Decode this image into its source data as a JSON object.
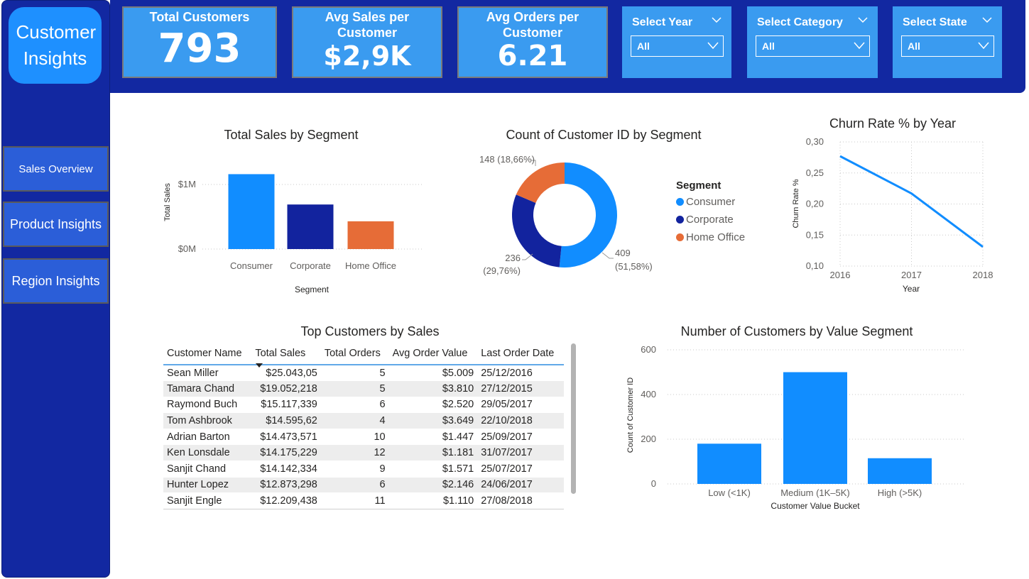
{
  "app": {
    "title": "Customer Insights"
  },
  "nav": [
    {
      "label": "Sales Overview"
    },
    {
      "label": "Product Insights"
    },
    {
      "label": "Region Insights"
    }
  ],
  "kpis": [
    {
      "title": "Total Customers",
      "value": "793"
    },
    {
      "title": "Avg Sales per Customer",
      "value": "$2,9K"
    },
    {
      "title": "Avg Orders per Customer",
      "value": "6.21"
    }
  ],
  "slicers": [
    {
      "title": "Select Year",
      "value": "All"
    },
    {
      "title": "Select Category",
      "value": "All"
    },
    {
      "title": "Select State",
      "value": "All"
    }
  ],
  "colors": {
    "navy": "#1228A1",
    "blue": "#118DFF",
    "darkblue": "#12239E",
    "orange": "#E66C37",
    "card": "#3A9BF0"
  },
  "charts": {
    "sales_by_segment": {
      "title": "Total Sales by Segment",
      "chart_data": {
        "type": "bar",
        "title": "Total Sales by Segment",
        "xlabel": "Segment",
        "ylabel": "Total Sales",
        "categories": [
          "Consumer",
          "Corporate",
          "Home Office"
        ],
        "values": [
          1160000,
          690000,
          430000
        ],
        "yticks": [
          "$0M",
          "$1M"
        ],
        "ylim": [
          0,
          1300000
        ],
        "colors": [
          "#118DFF",
          "#12239E",
          "#E66C37"
        ]
      }
    },
    "customer_count_by_segment": {
      "title": "Count of Customer ID by Segment",
      "legend_title": "Segment",
      "chart_data": {
        "type": "pie",
        "title": "Count of Customer ID by Segment",
        "categories": [
          "Consumer",
          "Corporate",
          "Home Office"
        ],
        "values": [
          409,
          236,
          148
        ],
        "labels": [
          "409",
          "(51,58%)",
          "236",
          "(29,76%)",
          "148 (18,66%)"
        ],
        "colors": [
          "#118DFF",
          "#12239E",
          "#E66C37"
        ],
        "legend": "right"
      }
    },
    "churn_rate": {
      "title": "Churn Rate % by Year",
      "chart_data": {
        "type": "line",
        "title": "Churn Rate % by Year",
        "xlabel": "Year",
        "ylabel": "Churn Rate %",
        "x": [
          "2016",
          "2017",
          "2018"
        ],
        "values": [
          0.277,
          0.217,
          0.131
        ],
        "yticks": [
          "0,10",
          "0,15",
          "0,20",
          "0,25",
          "0,30"
        ],
        "ylim": [
          0.1,
          0.3
        ],
        "grid": true
      }
    },
    "value_segment": {
      "title": "Number of Customers by Value Segment",
      "chart_data": {
        "type": "bar",
        "title": "Number of Customers by Value Segment",
        "xlabel": "Customer Value Bucket",
        "ylabel": "Count of Customer ID",
        "categories": [
          "Low (<1K)",
          "Medium (1K–5K)",
          "High (>5K)"
        ],
        "values": [
          180,
          500,
          115
        ],
        "yticks": [
          "0",
          "200",
          "400",
          "600"
        ],
        "ylim": [
          0,
          600
        ],
        "grid": true
      }
    }
  },
  "table": {
    "title": "Top Customers by Sales",
    "columns": [
      "Customer Name",
      "Total Sales",
      "Total Orders",
      "Avg Order Value",
      "Last Order Date"
    ],
    "rows": [
      [
        "Sean Miller",
        "$25.043,05",
        "5",
        "$5.009",
        "25/12/2016"
      ],
      [
        "Tamara Chand",
        "$19.052,218",
        "5",
        "$3.810",
        "27/12/2015"
      ],
      [
        "Raymond Buch",
        "$15.117,339",
        "6",
        "$2.520",
        "29/05/2017"
      ],
      [
        "Tom Ashbrook",
        "$14.595,62",
        "4",
        "$3.649",
        "22/10/2018"
      ],
      [
        "Adrian Barton",
        "$14.473,571",
        "10",
        "$1.447",
        "25/09/2017"
      ],
      [
        "Ken Lonsdale",
        "$14.175,229",
        "12",
        "$1.181",
        "31/07/2017"
      ],
      [
        "Sanjit Chand",
        "$14.142,334",
        "9",
        "$1.571",
        "25/07/2017"
      ],
      [
        "Hunter Lopez",
        "$12.873,298",
        "6",
        "$2.146",
        "24/06/2017"
      ],
      [
        "Sanjit Engle",
        "$12.209,438",
        "11",
        "$1.110",
        "27/08/2018"
      ]
    ]
  }
}
